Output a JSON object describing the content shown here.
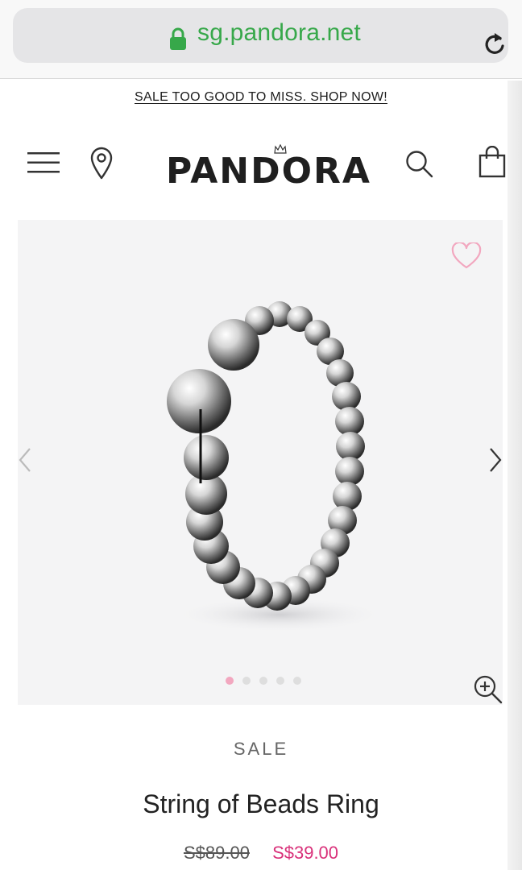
{
  "browser": {
    "url": "sg.pandora.net"
  },
  "promo": {
    "text": "SALE TOO GOOD TO MISS. SHOP NOW!"
  },
  "header": {
    "logo": "PANDORA"
  },
  "icons": {
    "menu": "hamburger-menu-icon",
    "location": "location-pin-icon",
    "search": "search-icon",
    "bag": "shopping-bag-icon",
    "wishlist": "heart-icon",
    "zoom": "zoom-in-icon"
  },
  "gallery": {
    "image_count": 5,
    "active_index": 0
  },
  "product": {
    "badge": "SALE",
    "name": "String of Beads Ring",
    "old_price": "S$89.00",
    "new_price": "S$39.00"
  },
  "colors": {
    "url_green": "#37a84a",
    "sale_pink": "#d9317a",
    "heart_pink": "#f2a7bf"
  }
}
